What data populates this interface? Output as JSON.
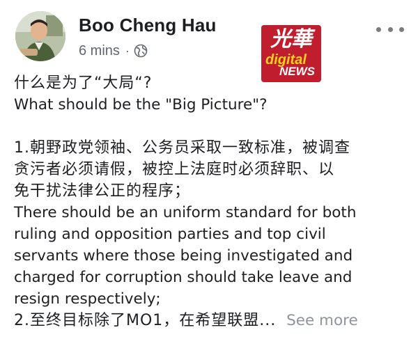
{
  "post": {
    "author_name": "Boo Cheng Hau",
    "timestamp": "6 mins",
    "separator": "·",
    "privacy_icon": "globe-icon",
    "more_icon": "more-options-icon",
    "watermark": {
      "chinese": "光華",
      "line1": "digital",
      "line2": "NEWS",
      "color": "#c01d2e"
    },
    "body": {
      "line1": "什么是为了“大局“?",
      "line2": "What should be the \"Big Picture\"?",
      "line3": "1.朝野政党领袖、公务员采取一致标准，被调查",
      "line4": "贪污者必须请假，被控上法庭时必须辞职、以",
      "line5": "免干扰法律公正的程序；",
      "line6": "There should be an uniform standard for both",
      "line7": "ruling and opposition parties and top civil",
      "line8": "servants where those being investigated and",
      "line9": "charged for corruption should take leave and",
      "line10": "resign respectively;",
      "line11": "2.至终目标除了MO1，在希望联盟...",
      "see_more": "See more"
    }
  }
}
